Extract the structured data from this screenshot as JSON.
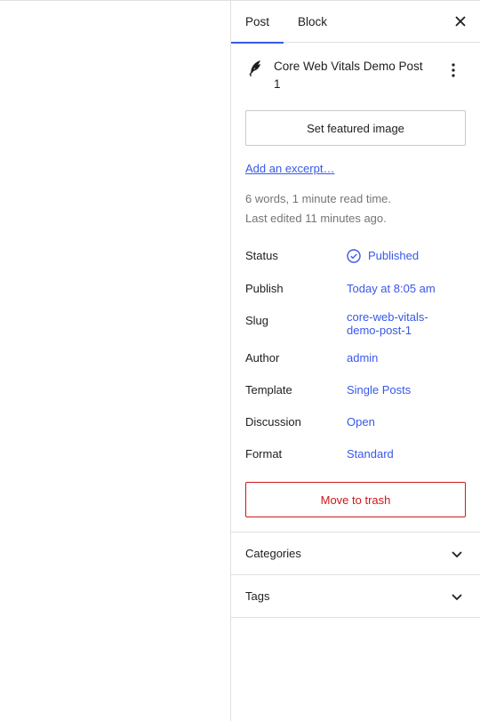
{
  "tabs": {
    "post": "Post",
    "block": "Block"
  },
  "post": {
    "title": "Core Web Vitals Demo Post 1"
  },
  "featured_image_label": "Set featured image",
  "excerpt_link": "Add an excerpt…",
  "meta": {
    "words_line": "6 words, 1 minute read time.",
    "edited_line": "Last edited 11 minutes ago."
  },
  "rows": {
    "status": {
      "label": "Status",
      "value": "Published"
    },
    "publish": {
      "label": "Publish",
      "value": "Today at 8:05 am"
    },
    "slug": {
      "label": "Slug",
      "value": "core-web-vitals-demo-post-1"
    },
    "author": {
      "label": "Author",
      "value": "admin"
    },
    "template": {
      "label": "Template",
      "value": "Single Posts"
    },
    "discussion": {
      "label": "Discussion",
      "value": "Open"
    },
    "format": {
      "label": "Format",
      "value": "Standard"
    }
  },
  "trash_label": "Move to trash",
  "panels": {
    "categories": "Categories",
    "tags": "Tags"
  },
  "colors": {
    "accent": "#3858e9",
    "danger": "#cc1818",
    "muted": "#757575",
    "border": "#e0e0e0"
  },
  "icons": {
    "close": "close-icon",
    "post": "feather-icon",
    "more": "more-vertical-icon",
    "status": "check-circle-icon",
    "chevron": "chevron-down-icon"
  }
}
